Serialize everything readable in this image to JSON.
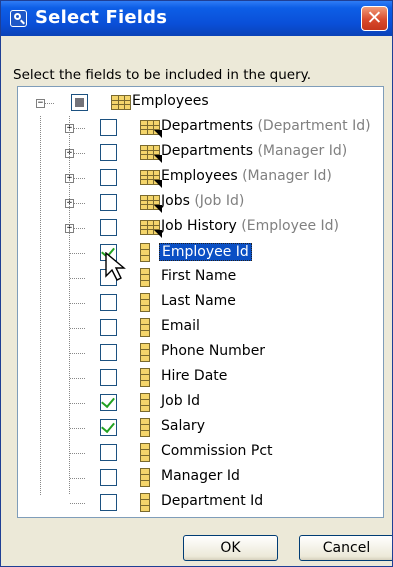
{
  "dialog": {
    "title": "Select Fields",
    "close_label": "✕",
    "instruction": "Select the fields to be included in the query."
  },
  "tree": {
    "root": {
      "label": "Employees",
      "expander": "−",
      "check": "partial"
    },
    "relations": [
      {
        "name": "Departments",
        "role": "(Department Id)",
        "expander": "+"
      },
      {
        "name": "Departments",
        "role": "(Manager Id)",
        "expander": "+"
      },
      {
        "name": "Employees",
        "role": "(Manager Id)",
        "expander": "+"
      },
      {
        "name": "Jobs",
        "role": "(Job Id)",
        "expander": "+"
      },
      {
        "name": "Job History",
        "role": "(Employee Id)",
        "expander": "+"
      }
    ],
    "fields": [
      {
        "label": "Employee Id",
        "checked": true,
        "selected": true
      },
      {
        "label": "First Name",
        "checked": false
      },
      {
        "label": "Last Name",
        "checked": false
      },
      {
        "label": "Email",
        "checked": false
      },
      {
        "label": "Phone Number",
        "checked": false
      },
      {
        "label": "Hire Date",
        "checked": false
      },
      {
        "label": "Job Id",
        "checked": true
      },
      {
        "label": "Salary",
        "checked": true
      },
      {
        "label": "Commission Pct",
        "checked": false
      },
      {
        "label": "Manager Id",
        "checked": false
      },
      {
        "label": "Department Id",
        "checked": false
      }
    ]
  },
  "buttons": {
    "ok": "OK",
    "cancel": "Cancel"
  }
}
